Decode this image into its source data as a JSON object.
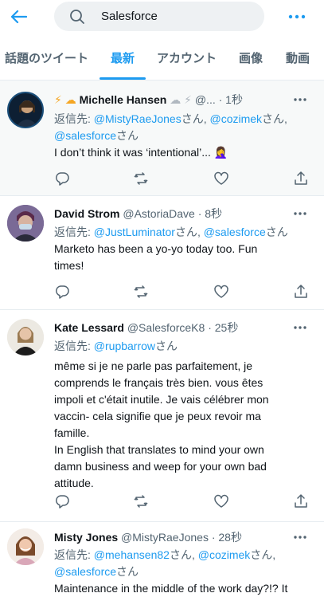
{
  "search": {
    "query": "Salesforce"
  },
  "tabs": [
    {
      "label": "話題のツイート"
    },
    {
      "label": "最新"
    },
    {
      "label": "アカウント"
    },
    {
      "label": "画像"
    },
    {
      "label": "動画"
    }
  ],
  "common": {
    "reply_prefix": "返信先:",
    "san": "さん",
    "comma": ", "
  },
  "tweets": [
    {
      "emoji_left": "⚡ ☁",
      "name": "Michelle Hansen",
      "emoji_right": "☁ ⚡",
      "handle": "@...",
      "time": "· 1秒",
      "reply_to": [
        "@MistyRaeJones",
        "@cozimek",
        "@salesforce"
      ],
      "text": "I don’t think it was ‘intentional’...",
      "text_emoji": "🤦‍♀️"
    },
    {
      "name": "David Strom",
      "handle": "@AstoriaDave",
      "time": "· 8秒",
      "reply_to": [
        "@JustLuminator",
        "@salesforce"
      ],
      "text_lines": [
        "Marketo has been a yo-yo today too.  Fun",
        "times!"
      ]
    },
    {
      "name": "Kate Lessard",
      "handle": "@SalesforceK8",
      "time": "· 25秒",
      "reply_to": [
        "@rupbarrow"
      ],
      "text_lines": [
        "même si je ne parle pas parfaitement, je",
        "comprends le français très bien. vous êtes",
        "impoli et c'était inutile. Je vais célébrer mon",
        "vaccin- cela signifie que je peux revoir ma",
        "famille.",
        "In English that translates to mind your own",
        "damn business and weep for your own bad",
        "attitude."
      ]
    },
    {
      "name": "Misty Jones",
      "handle": "@MistyRaeJones",
      "time": "· 28秒",
      "reply_to": [
        "@mehansen82",
        "@cozimek",
        "@salesforce"
      ],
      "text_lines": [
        "Maintenance in the middle of the work day?!? It"
      ]
    }
  ],
  "colors": {
    "accent": "#1d9bf0",
    "text": "#0f1419",
    "muted": "#536471",
    "divider": "#e6ecf0"
  }
}
